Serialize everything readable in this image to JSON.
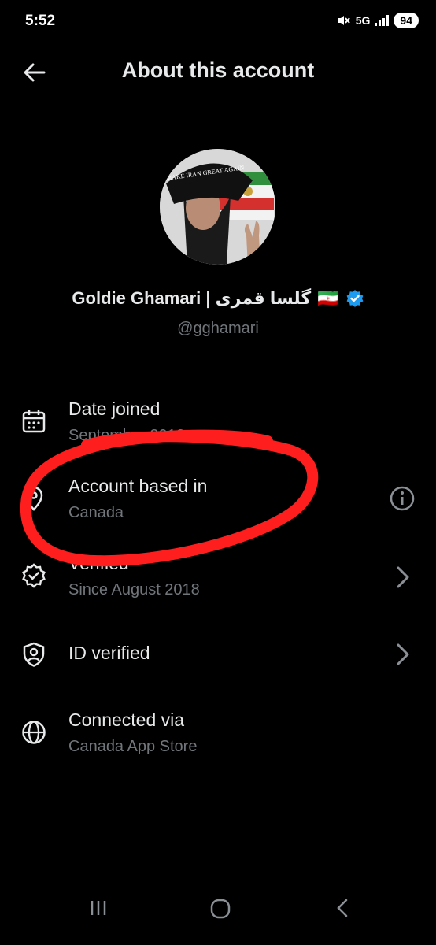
{
  "status_bar": {
    "time": "5:52",
    "network": "5G",
    "battery": "94"
  },
  "header": {
    "title": "About this account"
  },
  "profile": {
    "name": "Goldie Ghamari | گلسا قمری",
    "flag": "🇮🇷",
    "handle": "@gghamari",
    "avatar_hat_text": "MAKE IRAN GREAT AGAIN"
  },
  "rows": [
    {
      "label": "Date joined",
      "sub": "September 2012",
      "icon": "calendar-icon"
    },
    {
      "label": "Account based in",
      "sub": "Canada",
      "icon": "location-pin-icon",
      "right": "info-icon"
    },
    {
      "label": "Verified",
      "sub": "Since August 2018",
      "icon": "verified-badge-icon",
      "right": "chevron-right-icon"
    },
    {
      "label": "ID verified",
      "sub": "",
      "icon": "shield-person-icon",
      "right": "chevron-right-icon"
    },
    {
      "label": "Connected via",
      "sub": "Canada App Store",
      "icon": "globe-icon"
    }
  ],
  "colors": {
    "background": "#000000",
    "text": "#e7e9ea",
    "muted": "#71767b",
    "verified": "#1d9bf0",
    "annotation": "#ff1e1e"
  }
}
